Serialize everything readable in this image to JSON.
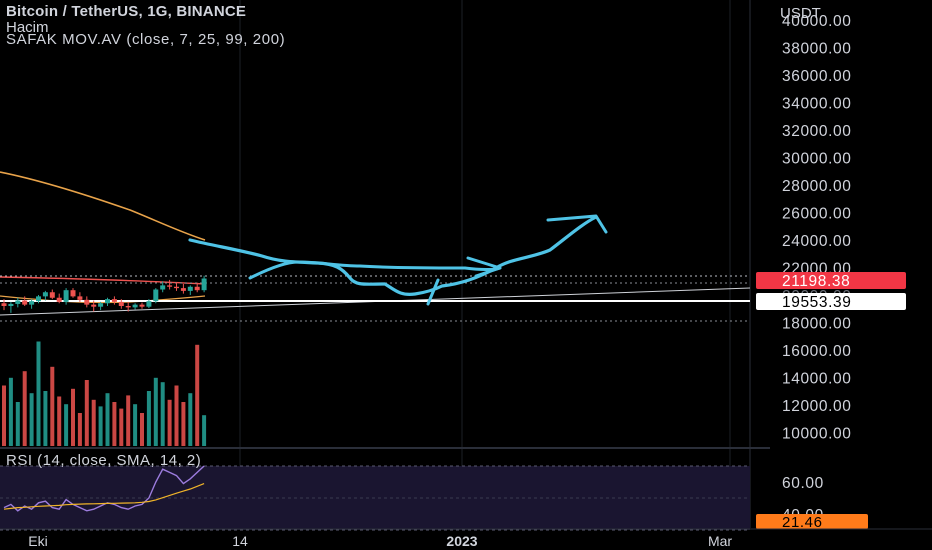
{
  "header": {
    "title": "Bitcoin / TetherUS, 1G, BINANCE",
    "volume_label": "Hacim",
    "ma_label": "SAFAK  MOV.AV (close, 7, 25, 99, 200)",
    "rsi_label": "RSI (14, close, SMA, 14, 2)"
  },
  "price_axis": {
    "currency": "USDT",
    "ticks": [
      "40000.00",
      "38000.00",
      "36000.00",
      "34000.00",
      "32000.00",
      "30000.00",
      "28000.00",
      "26000.00",
      "24000.00",
      "22000.00",
      "18000.00",
      "16000.00",
      "14000.00",
      "12000.00",
      "10000.00"
    ],
    "current_price": "21198.38",
    "line_price": "19553.39",
    "hidden_label": "20000.00"
  },
  "rsi_axis": {
    "ticks": [
      "60.00",
      "40.00"
    ],
    "current": "21.46"
  },
  "time_axis": {
    "labels": [
      "Eki",
      "14",
      "2023",
      "Mar"
    ]
  },
  "colors": {
    "up": "#26a69a",
    "down": "#ef5350",
    "ma_long": "#e8a34a",
    "ma_short": "#ef5350",
    "drawing": "#4fc3e6",
    "price_badge": "#f23645",
    "rsi_badge": "#ff7b1a",
    "rsi_line": "#9c7cde",
    "rsi_ma": "#f0b429"
  },
  "chart_data": {
    "type": "candlestick",
    "title": "Bitcoin / TetherUS, 1G, BINANCE",
    "ylabel": "USDT",
    "ylim": [
      9000,
      40500
    ],
    "x_labels": [
      "Eki",
      "14",
      "2023",
      "Mar"
    ],
    "candles": [
      {
        "o": 19400,
        "h": 19700,
        "l": 18900,
        "c": 19200
      },
      {
        "o": 19200,
        "h": 19500,
        "l": 18700,
        "c": 19350
      },
      {
        "o": 19350,
        "h": 19800,
        "l": 19100,
        "c": 19600
      },
      {
        "o": 19600,
        "h": 19900,
        "l": 19200,
        "c": 19300
      },
      {
        "o": 19300,
        "h": 19700,
        "l": 19000,
        "c": 19550
      },
      {
        "o": 19550,
        "h": 20000,
        "l": 19400,
        "c": 19900
      },
      {
        "o": 19900,
        "h": 20300,
        "l": 19600,
        "c": 20200
      },
      {
        "o": 20200,
        "h": 20400,
        "l": 19700,
        "c": 19800
      },
      {
        "o": 19800,
        "h": 20100,
        "l": 19400,
        "c": 19500
      },
      {
        "o": 19500,
        "h": 20500,
        "l": 19300,
        "c": 20350
      },
      {
        "o": 20350,
        "h": 20500,
        "l": 19800,
        "c": 19900
      },
      {
        "o": 19900,
        "h": 20200,
        "l": 19500,
        "c": 19650
      },
      {
        "o": 19650,
        "h": 19900,
        "l": 19100,
        "c": 19300
      },
      {
        "o": 19300,
        "h": 19600,
        "l": 18800,
        "c": 19150
      },
      {
        "o": 19150,
        "h": 19500,
        "l": 18900,
        "c": 19400
      },
      {
        "o": 19400,
        "h": 19800,
        "l": 19200,
        "c": 19700
      },
      {
        "o": 19700,
        "h": 19900,
        "l": 19300,
        "c": 19500
      },
      {
        "o": 19500,
        "h": 19700,
        "l": 19000,
        "c": 19200
      },
      {
        "o": 19200,
        "h": 19500,
        "l": 18800,
        "c": 19100
      },
      {
        "o": 19100,
        "h": 19400,
        "l": 18950,
        "c": 19300
      },
      {
        "o": 19300,
        "h": 19450,
        "l": 19000,
        "c": 19150
      },
      {
        "o": 19150,
        "h": 19700,
        "l": 19050,
        "c": 19550
      },
      {
        "o": 19550,
        "h": 20500,
        "l": 19400,
        "c": 20400
      },
      {
        "o": 20400,
        "h": 21000,
        "l": 20200,
        "c": 20700
      },
      {
        "o": 20700,
        "h": 21100,
        "l": 20400,
        "c": 20600
      },
      {
        "o": 20600,
        "h": 20900,
        "l": 20300,
        "c": 20500
      },
      {
        "o": 20500,
        "h": 20800,
        "l": 20100,
        "c": 20300
      },
      {
        "o": 20300,
        "h": 20700,
        "l": 20000,
        "c": 20600
      },
      {
        "o": 20600,
        "h": 20900,
        "l": 20200,
        "c": 20350
      },
      {
        "o": 20350,
        "h": 21400,
        "l": 20200,
        "c": 21200
      }
    ],
    "volume": [
      0.55,
      0.62,
      0.4,
      0.68,
      0.48,
      0.95,
      0.5,
      0.72,
      0.45,
      0.38,
      0.52,
      0.3,
      0.6,
      0.42,
      0.36,
      0.48,
      0.4,
      0.34,
      0.46,
      0.38,
      0.3,
      0.5,
      0.62,
      0.58,
      0.42,
      0.55,
      0.4,
      0.48,
      0.92,
      0.28
    ],
    "current_price": 21198.38,
    "horizontal_line": 19553.39,
    "rsi": {
      "ylim": [
        20,
        80
      ],
      "ticks": [
        60,
        40
      ],
      "values": [
        44,
        46,
        42,
        45,
        43,
        47,
        48,
        44,
        43,
        49,
        46,
        44,
        42,
        43,
        45,
        47,
        46,
        44,
        43,
        45,
        46,
        50,
        60,
        68,
        66,
        64,
        59,
        62,
        66,
        70
      ],
      "ma_values": [
        43,
        43.5,
        44,
        44.2,
        44.5,
        44.8,
        45,
        45.2,
        45.4,
        45.8,
        46,
        46.2,
        46.3,
        46.4,
        46.5,
        46.6,
        46.7,
        46.8,
        46.9,
        47,
        47.3,
        47.8,
        48.8,
        50.2,
        51.6,
        53,
        54.3,
        55.6,
        57.3,
        59
      ],
      "current": 21.46
    }
  }
}
